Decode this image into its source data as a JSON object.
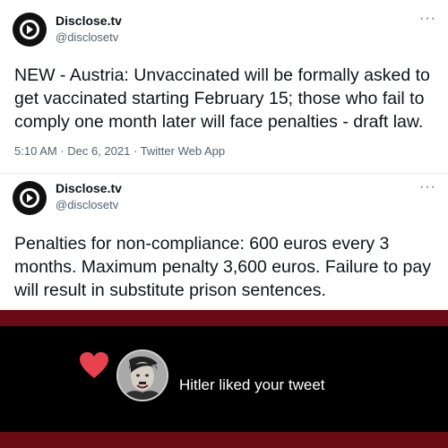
{
  "tweet1": {
    "name": "Disclose.tv",
    "handle": "@disclosetv",
    "more": "···",
    "text": "NEW - Austria: Unvaccinated will be formally asked to get vaccinated starting February 15; those who fail to comply one month later will face penalties - draft law.",
    "meta": "5:10 AM · Dec 6, 2021 · Twitter Web App"
  },
  "tweet2": {
    "name": "Disclose.tv",
    "handle": "@disclosetv",
    "more": "···",
    "text": "Penalties for non-compliance: 600 euros every 3 months. Maximum penalty 3,600 euros. Failure to pay will result in substitute prison sentences."
  },
  "notification": {
    "text": "Hitler liked your tweet",
    "heart_icon": "heart-icon",
    "heart_color": "#e8424f",
    "bar_color": "#000000",
    "stripe_color": "#6b0a12"
  }
}
